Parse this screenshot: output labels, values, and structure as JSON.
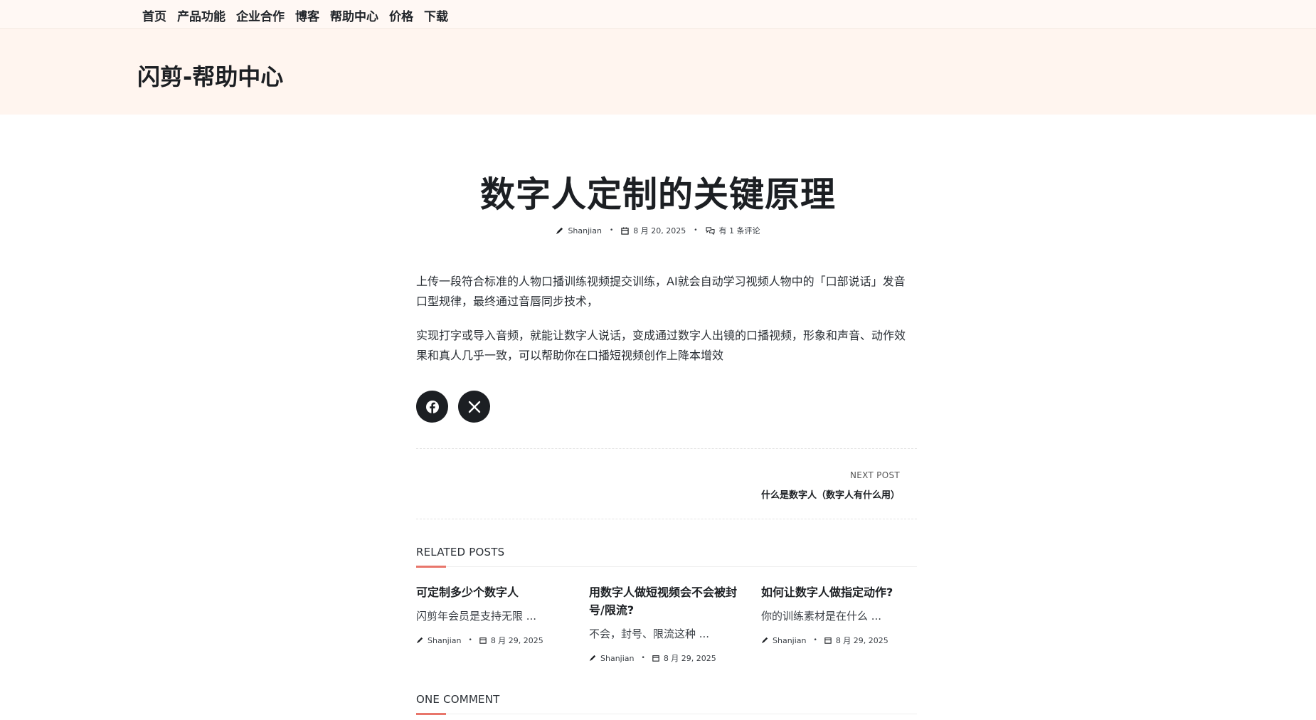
{
  "nav": {
    "items": [
      "首页",
      "产品功能",
      "企业合作",
      "博客",
      "帮助中心",
      "价格",
      "下载"
    ]
  },
  "site": {
    "title": "闪剪-帮助中心"
  },
  "post": {
    "title": "数字人定制的关键原理",
    "author": "Shanjian",
    "date": "8 月 20, 2025",
    "comments": "有 1 条评论",
    "paragraphs": [
      "上传一段符合标准的人物口播训练视频提交训练，AI就会自动学习视频人物中的「口部说话」发音口型规律，最终通过音唇同步技术，",
      "实现打字或导入音频，就能让数字人说话，变成通过数字人出镜的口播视频，形象和声音、动作效果和真人几乎一致，可以帮助你在口播短视频创作上降本增效"
    ]
  },
  "share": {
    "icons": [
      "facebook-icon",
      "x-icon"
    ]
  },
  "next_post": {
    "label": "NEXT POST",
    "title": "什么是数字人（数字人有什么用）"
  },
  "related": {
    "heading": "RELATED POSTS",
    "posts": [
      {
        "title": "可定制多少个数字人",
        "excerpt": "闪剪年会员是支持无限 ...",
        "author": "Shanjian",
        "date": "8 月 29, 2025"
      },
      {
        "title": "用数字人做短视频会不会被封号/限流?",
        "excerpt": "不会，封号、限流这种 ...",
        "author": "Shanjian",
        "date": "8 月 29, 2025"
      },
      {
        "title": "如何让数字人做指定动作?",
        "excerpt": "你的训练素材是在什么 ...",
        "author": "Shanjian",
        "date": "8 月 29, 2025"
      }
    ]
  },
  "comments": {
    "heading": "ONE COMMENT"
  },
  "colors": {
    "accent": "#e8766b",
    "header_bg": "#fff5ef",
    "dark": "#1c1f23"
  }
}
